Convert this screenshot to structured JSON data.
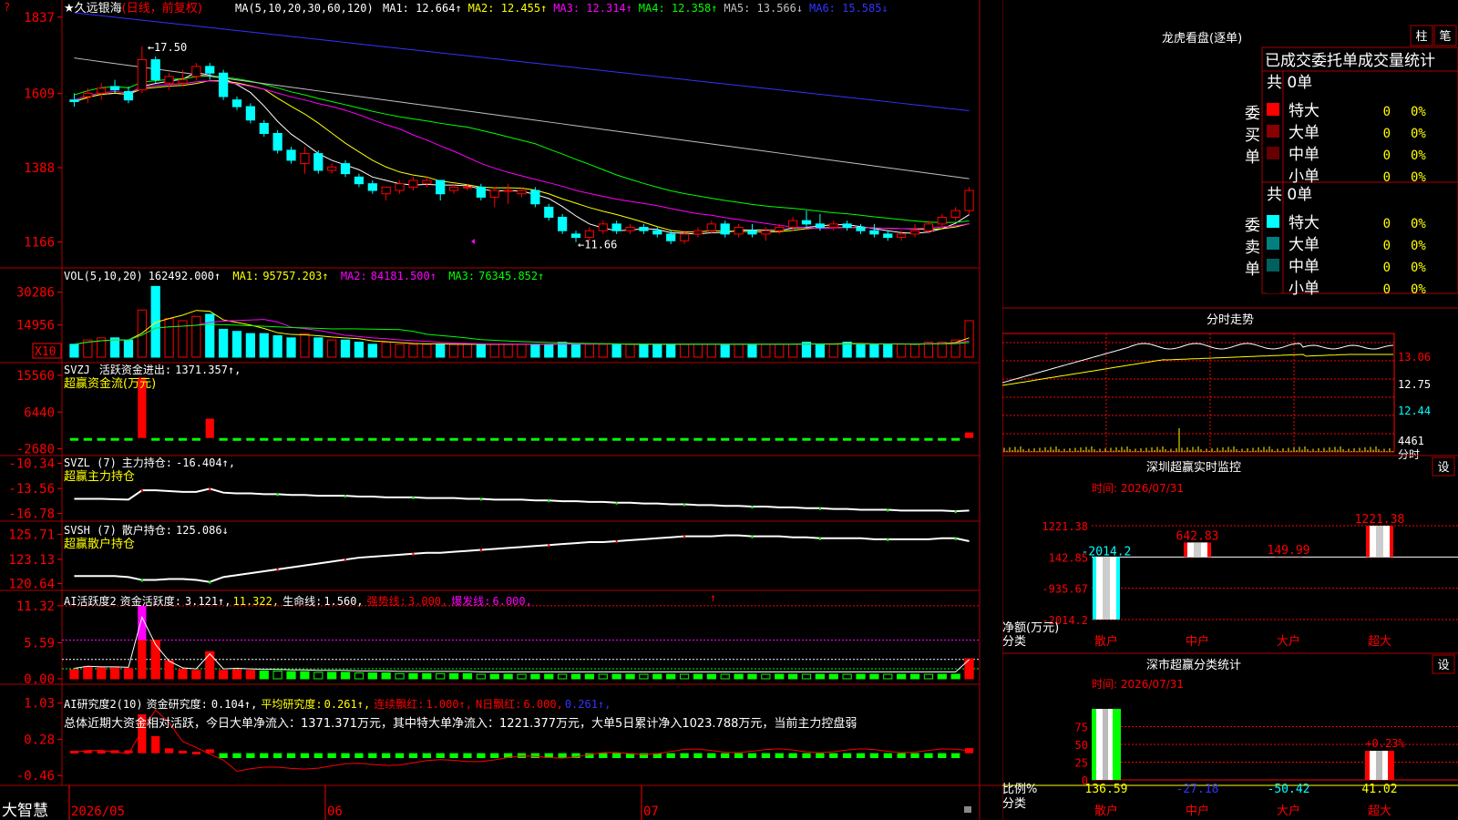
{
  "colors": {
    "up": "#ff0000",
    "down": "#00ffff",
    "grid": "#aa0000",
    "white": "#ffffff",
    "yellow": "#ffff00",
    "magenta": "#ff00ff",
    "green": "#00ff00",
    "blue": "#3333ff",
    "gray": "#c0c0c0"
  },
  "main": {
    "name": "★久远银海",
    "period": "(日线，前复权)",
    "ma_label": "MA(5,10,20,30,60,120)",
    "ma": [
      {
        "name": "MA1:",
        "value": "12.664↑",
        "color": "#ffffff"
      },
      {
        "name": "MA2:",
        "value": "12.455↑",
        "color": "#ffff00"
      },
      {
        "name": "MA3:",
        "value": "12.314↑",
        "color": "#ff00ff"
      },
      {
        "name": "MA4:",
        "value": "12.358↑",
        "color": "#00ff00"
      },
      {
        "name": "MA5:",
        "value": "13.566↓",
        "color": "#c0c0c0"
      },
      {
        "name": "MA6:",
        "value": "15.585↓",
        "color": "#3333ff"
      }
    ],
    "yticks": [
      "1837",
      "1609",
      "1388",
      "1166"
    ],
    "high_label": "←17.50",
    "low_label": "←11.66",
    "chart_data": {
      "type": "candlestick",
      "ylim": [
        11.0,
        18.5
      ],
      "x_labels": [
        "2026/05",
        "06",
        "07"
      ],
      "ohlc": [
        [
          15.9,
          16.1,
          15.7,
          15.85
        ],
        [
          16.0,
          16.25,
          15.8,
          16.1
        ],
        [
          16.1,
          16.4,
          15.9,
          16.25
        ],
        [
          16.3,
          16.5,
          16.1,
          16.2
        ],
        [
          16.15,
          16.3,
          15.8,
          15.9
        ],
        [
          16.2,
          17.5,
          16.1,
          17.1
        ],
        [
          17.1,
          17.2,
          16.4,
          16.5
        ],
        [
          16.4,
          16.7,
          16.2,
          16.6
        ],
        [
          16.4,
          16.8,
          16.3,
          16.5
        ],
        [
          16.6,
          17.0,
          16.5,
          16.9
        ],
        [
          16.9,
          17.0,
          16.5,
          16.7
        ],
        [
          16.7,
          16.8,
          15.9,
          16.0
        ],
        [
          15.9,
          16.0,
          15.6,
          15.7
        ],
        [
          15.7,
          15.8,
          15.2,
          15.3
        ],
        [
          15.2,
          15.3,
          14.8,
          14.9
        ],
        [
          14.9,
          15.0,
          14.3,
          14.4
        ],
        [
          14.4,
          14.5,
          14.0,
          14.1
        ],
        [
          14.0,
          14.5,
          13.7,
          14.3
        ],
        [
          14.3,
          14.4,
          13.7,
          13.8
        ],
        [
          13.8,
          14.0,
          13.7,
          13.9
        ],
        [
          14.0,
          14.1,
          13.6,
          13.7
        ],
        [
          13.6,
          13.7,
          13.3,
          13.4
        ],
        [
          13.4,
          13.5,
          13.1,
          13.2
        ],
        [
          13.1,
          13.3,
          12.9,
          13.3
        ],
        [
          13.2,
          13.5,
          13.1,
          13.4
        ],
        [
          13.3,
          13.6,
          13.2,
          13.5
        ],
        [
          13.4,
          13.6,
          13.3,
          13.5
        ],
        [
          13.5,
          13.5,
          12.9,
          13.1
        ],
        [
          13.2,
          13.4,
          13.1,
          13.3
        ],
        [
          13.3,
          13.4,
          13.2,
          13.3
        ],
        [
          13.3,
          13.4,
          12.9,
          13.0
        ],
        [
          13.0,
          13.3,
          12.7,
          13.2
        ],
        [
          13.2,
          13.4,
          12.8,
          13.2
        ],
        [
          13.1,
          13.3,
          13.0,
          13.2
        ],
        [
          13.2,
          13.3,
          12.7,
          12.8
        ],
        [
          12.7,
          12.8,
          12.3,
          12.4
        ],
        [
          12.4,
          12.5,
          11.9,
          12.0
        ],
        [
          11.9,
          12.0,
          11.66,
          11.8
        ],
        [
          11.8,
          12.1,
          11.7,
          12.0
        ],
        [
          12.0,
          12.3,
          11.9,
          12.2
        ],
        [
          12.2,
          12.3,
          11.9,
          12.0
        ],
        [
          12.0,
          12.2,
          11.9,
          12.1
        ],
        [
          12.1,
          12.2,
          11.9,
          12.0
        ],
        [
          12.0,
          12.1,
          11.8,
          11.9
        ],
        [
          11.9,
          12.0,
          11.6,
          11.7
        ],
        [
          11.7,
          12.0,
          11.6,
          11.9
        ],
        [
          11.9,
          12.1,
          11.8,
          12.0
        ],
        [
          12.0,
          12.3,
          11.9,
          12.2
        ],
        [
          12.2,
          12.3,
          11.8,
          11.9
        ],
        [
          11.9,
          12.2,
          11.8,
          12.1
        ],
        [
          12.0,
          12.2,
          11.8,
          11.9
        ],
        [
          11.9,
          12.1,
          11.7,
          12.0
        ],
        [
          12.0,
          12.2,
          11.9,
          12.1
        ],
        [
          12.1,
          12.4,
          12.0,
          12.3
        ],
        [
          12.3,
          12.6,
          12.1,
          12.2
        ],
        [
          12.2,
          12.5,
          12.0,
          12.1
        ],
        [
          12.1,
          12.3,
          12.0,
          12.2
        ],
        [
          12.2,
          12.3,
          12.0,
          12.1
        ],
        [
          12.1,
          12.2,
          11.9,
          12.0
        ],
        [
          12.0,
          12.2,
          11.8,
          11.9
        ],
        [
          11.9,
          12.0,
          11.7,
          11.8
        ],
        [
          11.8,
          12.0,
          11.7,
          11.9
        ],
        [
          11.9,
          12.2,
          11.8,
          12.0
        ],
        [
          12.0,
          12.3,
          11.9,
          12.2
        ],
        [
          12.2,
          12.5,
          12.1,
          12.4
        ],
        [
          12.4,
          12.7,
          12.3,
          12.6
        ],
        [
          12.6,
          13.3,
          12.5,
          13.2
        ]
      ]
    }
  },
  "vol": {
    "label": "VOL(5,10,20)",
    "value": "162492.000↑",
    "ma": [
      {
        "name": "MA1:",
        "value": "95757.203↑",
        "color": "#ffff00"
      },
      {
        "name": "MA2:",
        "value": "84181.500↑",
        "color": "#ff00ff"
      },
      {
        "name": "MA3:",
        "value": "76345.852↑",
        "color": "#00ff00"
      }
    ],
    "yticks": [
      "30286",
      "14956"
    ],
    "unit": "X10",
    "chart_data": {
      "type": "bar",
      "values": [
        6,
        8,
        9,
        9,
        8,
        22,
        33,
        18,
        17,
        19,
        20,
        13,
        12,
        11,
        11,
        10,
        9,
        11,
        9,
        8,
        8,
        7,
        6,
        7,
        6,
        6,
        6,
        6,
        6,
        6,
        6,
        6,
        6,
        6,
        6,
        6,
        7,
        6,
        6,
        6,
        6,
        6,
        6,
        6,
        6,
        6,
        6,
        6,
        6,
        6,
        6,
        6,
        6,
        6,
        7,
        6,
        6,
        7,
        6,
        6,
        6,
        6,
        6,
        7,
        7,
        8,
        17
      ],
      "ylim": [
        0,
        34
      ]
    }
  },
  "svzj": {
    "label": "SVZJ",
    "name": "活跃资金进出:",
    "value": "1371.357↑,",
    "title": "超赢资金流(万元)",
    "yticks": [
      "15560",
      "6440",
      "-2680"
    ],
    "chart_data": {
      "type": "bar",
      "values": [
        -400,
        -300,
        -300,
        -200,
        -300,
        15000,
        -300,
        -400,
        -300,
        -300,
        4800,
        -500,
        -700,
        -400,
        -300,
        -400,
        -300,
        -400,
        -300,
        -400,
        -300,
        -300,
        -300,
        -400,
        -300,
        -300,
        -300,
        -400,
        -300,
        -300,
        -300,
        -300,
        -300,
        -400,
        -300,
        -300,
        -300,
        -300,
        -300,
        -300,
        -300,
        -300,
        -300,
        -300,
        -300,
        -300,
        -300,
        -300,
        -300,
        -300,
        -300,
        -300,
        -300,
        -300,
        -300,
        -300,
        -300,
        -300,
        -300,
        -300,
        -300,
        -300,
        -300,
        -300,
        -300,
        -300,
        1371
      ],
      "ylim": [
        -3000,
        16000
      ]
    }
  },
  "svzl": {
    "label": "SVZL (7)",
    "name": "主力持仓:",
    "value": "-16.404↑,",
    "title": "超赢主力持仓",
    "yticks": [
      "-10.34",
      "-13.56",
      "-16.78"
    ],
    "chart_data": {
      "type": "line",
      "values": [
        -14.9,
        -14.9,
        -14.9,
        -14.95,
        -15.0,
        -13.8,
        -13.8,
        -13.9,
        -14.0,
        -14.0,
        -13.6,
        -14.1,
        -14.2,
        -14.2,
        -14.3,
        -14.3,
        -14.4,
        -14.4,
        -14.5,
        -14.5,
        -14.5,
        -14.6,
        -14.6,
        -14.7,
        -14.7,
        -14.7,
        -14.8,
        -14.8,
        -14.8,
        -14.9,
        -14.9,
        -15.0,
        -15.0,
        -15.0,
        -15.1,
        -15.1,
        -15.2,
        -15.2,
        -15.3,
        -15.3,
        -15.4,
        -15.4,
        -15.5,
        -15.5,
        -15.6,
        -15.6,
        -15.7,
        -15.7,
        -15.8,
        -15.8,
        -15.9,
        -15.9,
        -16.0,
        -16.0,
        -16.1,
        -16.1,
        -16.2,
        -16.2,
        -16.3,
        -16.3,
        -16.3,
        -16.4,
        -16.4,
        -16.4,
        -16.4,
        -16.5,
        -16.4
      ],
      "ylim": [
        -17.3,
        -9.8
      ]
    }
  },
  "svsh": {
    "label": "SVSH (7)",
    "name": "散户持仓:",
    "value": "125.086↓",
    "title": "超赢散户持仓",
    "yticks": [
      "125.71",
      "123.13",
      "120.64"
    ],
    "chart_data": {
      "type": "line",
      "values": [
        121.4,
        121.4,
        121.4,
        121.4,
        121.3,
        121.0,
        121.0,
        121.1,
        121.1,
        121.0,
        120.8,
        121.3,
        121.5,
        121.7,
        121.9,
        122.1,
        122.3,
        122.5,
        122.7,
        122.9,
        123.1,
        123.3,
        123.4,
        123.5,
        123.6,
        123.7,
        123.8,
        123.8,
        123.9,
        124.0,
        124.1,
        124.2,
        124.3,
        124.4,
        124.5,
        124.6,
        124.7,
        124.8,
        124.9,
        124.9,
        125.0,
        125.1,
        125.2,
        125.3,
        125.4,
        125.5,
        125.5,
        125.5,
        125.6,
        125.6,
        125.5,
        125.5,
        125.5,
        125.4,
        125.4,
        125.3,
        125.3,
        125.3,
        125.3,
        125.2,
        125.2,
        125.2,
        125.2,
        125.2,
        125.3,
        125.3,
        125.0
      ],
      "ylim": [
        120.3,
        126.5
      ]
    }
  },
  "ai1": {
    "label": "AI活跃度2",
    "name": "资金活跃度:",
    "value": "3.121↑,",
    "v2": "11.322,",
    "life": "生命线:",
    "life_v": "1.560,",
    "strong": "强势线:",
    "strong_v": "3.000,",
    "burst": "爆发线:",
    "burst_v": "6.000,",
    "yticks": [
      "11.32",
      "5.59",
      "0.00"
    ],
    "chart_data": {
      "type": "bar",
      "values": [
        1.4,
        1.8,
        1.7,
        1.7,
        1.6,
        11.3,
        6.0,
        2.8,
        1.5,
        1.3,
        4.2,
        1.3,
        1.4,
        1.3,
        1.2,
        1.2,
        1.1,
        1.1,
        1.0,
        1.0,
        1.0,
        0.9,
        0.9,
        0.9,
        0.8,
        0.8,
        0.8,
        0.8,
        0.8,
        0.8,
        0.7,
        0.7,
        0.7,
        0.7,
        0.7,
        0.7,
        0.7,
        0.7,
        0.7,
        0.7,
        0.7,
        0.7,
        0.7,
        0.7,
        0.7,
        0.7,
        0.7,
        0.7,
        0.7,
        0.7,
        0.7,
        0.7,
        0.7,
        0.7,
        0.7,
        0.7,
        0.7,
        0.7,
        0.7,
        0.7,
        0.7,
        0.7,
        0.7,
        0.7,
        0.7,
        0.7,
        3.1
      ],
      "ylim": [
        0,
        12.0
      ]
    }
  },
  "ai2": {
    "label": "AI研究度2(10)",
    "name": "资金研究度:",
    "value": "0.104↑,",
    "avg": "平均研究度:",
    "avg_v": "0.261↑,",
    "cont": "连续飘红:",
    "cont_v": "1.000↑,",
    "ndays": "N日飘红:",
    "ndays_v": "6.000,",
    "last": "0.261↑,",
    "summary": "总体近期大资金相对活跃，今日大单净流入：1371.371万元，其中特大单净流入：1221.377万元，大单5日累计净入1023.788万元，当前主力控盘弱",
    "yticks": [
      "1.03",
      "0.28",
      "-0.46"
    ],
    "chart_data": {
      "type": "bar",
      "values": [
        0.05,
        0.06,
        0.05,
        0.06,
        0.06,
        0.8,
        0.35,
        0.1,
        0.05,
        0.03,
        0.08,
        -0.1,
        -0.1,
        -0.1,
        -0.1,
        -0.1,
        -0.1,
        -0.1,
        -0.1,
        -0.1,
        -0.1,
        -0.1,
        -0.1,
        -0.1,
        -0.1,
        -0.1,
        -0.1,
        -0.1,
        -0.1,
        -0.1,
        -0.1,
        -0.1,
        -0.1,
        -0.1,
        -0.1,
        -0.1,
        -0.1,
        -0.1,
        -0.1,
        -0.1,
        -0.1,
        -0.1,
        -0.1,
        -0.1,
        -0.1,
        -0.1,
        -0.1,
        -0.1,
        -0.1,
        -0.1,
        -0.1,
        -0.1,
        -0.1,
        -0.1,
        -0.1,
        -0.1,
        -0.1,
        -0.1,
        -0.1,
        -0.1,
        -0.1,
        -0.1,
        -0.1,
        -0.1,
        -0.1,
        -0.1,
        0.104
      ],
      "ylim": [
        -0.55,
        1.1
      ]
    }
  },
  "bottom": {
    "brand": "大智慧",
    "x_labels": [
      "2026/05",
      "06",
      "07"
    ]
  },
  "right": {
    "lhb_title": "龙虎看盘(逐单)",
    "btn1": "柱",
    "btn2": "笔",
    "stat_title": "已成交委托单成交量统计",
    "buy": {
      "total": "共 0单",
      "side": "委买单",
      "rows": [
        {
          "label": "特大",
          "count": "0",
          "pct": "0%",
          "color": "#ff0000"
        },
        {
          "label": "大单",
          "count": "0",
          "pct": "0%",
          "color": "#880000"
        },
        {
          "label": "中单",
          "count": "0",
          "pct": "0%",
          "color": "#660000"
        },
        {
          "label": "小单",
          "count": "0",
          "pct": "0%",
          "color": "#000000"
        }
      ]
    },
    "sell": {
      "total": "共 0单",
      "side": "委卖单",
      "rows": [
        {
          "label": "特大",
          "count": "0",
          "pct": "0%",
          "color": "#00ffff"
        },
        {
          "label": "大单",
          "count": "0",
          "pct": "0%",
          "color": "#008080"
        },
        {
          "label": "中单",
          "count": "0",
          "pct": "0%",
          "color": "#006060"
        },
        {
          "label": "小单",
          "count": "0",
          "pct": "0%",
          "color": "#000000"
        }
      ]
    },
    "fs_title": "分时走势",
    "fs_yticks": [
      "13.06",
      "12.75",
      "12.44"
    ],
    "fs_vol": "4461",
    "fs_unit": "分时",
    "sz_title": "深圳超赢实时监控",
    "sz_btn": "设",
    "sz_time": "时间: 2026/07/31",
    "sz_yticks": [
      "1221.38",
      "142.85",
      "-935.67",
      "-2014.2"
    ],
    "sz_unit": "净额(万元)",
    "sz_cat": "分类",
    "sz_chart": {
      "type": "bar",
      "categories": [
        "散户",
        "中户",
        "大户",
        "超大"
      ],
      "values": [
        -2014.2,
        642.83,
        149.99,
        1221.38
      ],
      "labels": [
        "-2014.2",
        "642.83",
        "149.99",
        "1221.38"
      ],
      "ylim": [
        -2014.2,
        1221.38
      ]
    },
    "sc_title": "深市超赢分类统计",
    "sc_btn": "设",
    "sc_time": "时间: 2026/07/31",
    "sc_yticks": [
      "75",
      "50",
      "25",
      "0"
    ],
    "sc_unit": "比例%",
    "sc_cat": "分类",
    "sc_chart": {
      "type": "bar",
      "categories": [
        "散户",
        "中户",
        "大户",
        "超大"
      ],
      "values": [
        136.59,
        -27.18,
        -50.42,
        41.02
      ],
      "labels": [
        "136.59",
        "-27.18",
        "-50.42",
        "41.02"
      ],
      "pct_label": "+0.23%"
    }
  }
}
